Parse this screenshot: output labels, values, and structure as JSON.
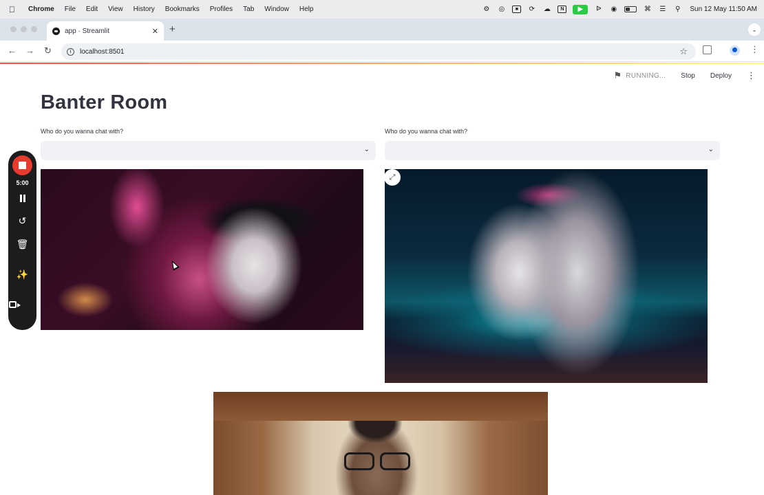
{
  "menubar": {
    "app_name": "Chrome",
    "items": [
      "File",
      "Edit",
      "View",
      "History",
      "Bookmarks",
      "Profiles",
      "Tab",
      "Window",
      "Help"
    ],
    "datetime": "Sun 12 May  11:50 AM"
  },
  "browser": {
    "tab_title": "app · Streamlit",
    "url": "localhost:8501"
  },
  "streamlit": {
    "status": "RUNNING...",
    "stop_label": "Stop",
    "deploy_label": "Deploy",
    "accent": "#ff4b4b"
  },
  "page": {
    "title": "Banter Room",
    "left_select": {
      "label": "Who do you wanna chat with?",
      "value": ""
    },
    "right_select": {
      "label": "Who do you wanna chat with?",
      "value": ""
    }
  },
  "recorder": {
    "timer": "5:00",
    "record_color": "#e83b30"
  }
}
